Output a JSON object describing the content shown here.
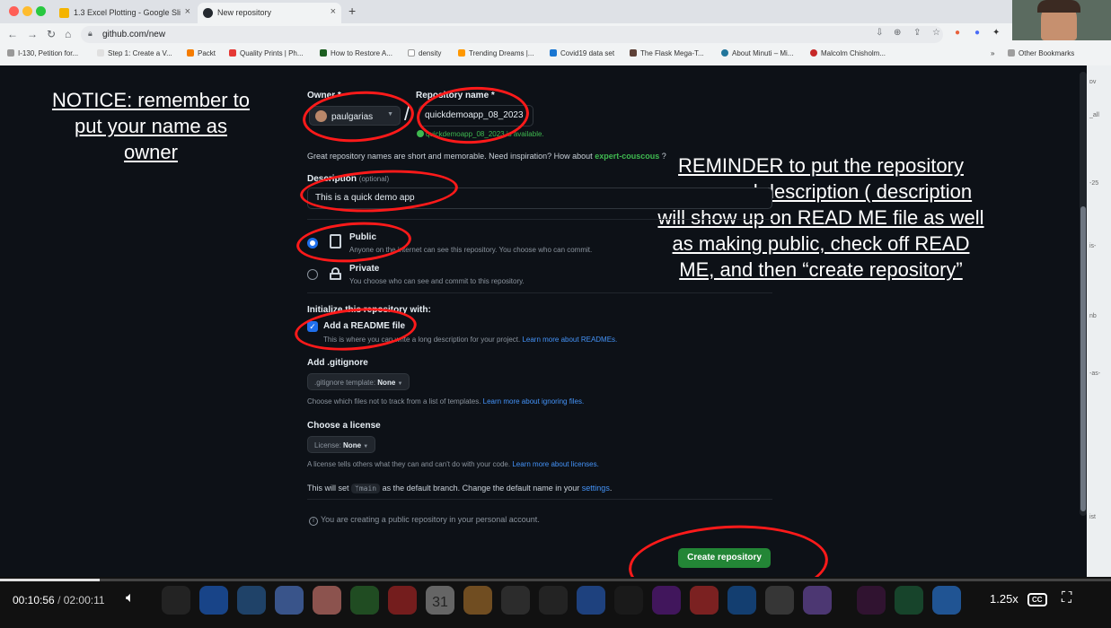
{
  "browser": {
    "tabs": [
      {
        "title": "1.3 Excel Plotting - Google Sli",
        "color": "#f4b400"
      },
      {
        "title": "New repository",
        "color": "#24292f"
      }
    ],
    "url": "github.com/new",
    "bookmarks": [
      "I-130, Petition for...",
      "Step 1: Create a V...",
      "Packt",
      "Quality Prints | Ph...",
      "How to Restore A...",
      "density",
      "Trending Dreams |...",
      "Covid19 data set",
      "The Flask Mega-T...",
      "About Minuti – Mi...",
      "Malcolm Chisholm...",
      "Other Bookmarks"
    ]
  },
  "notes": {
    "left": "NOTICE: remember to put your name as owner",
    "right": "REMINDER to put the repository name and description ( description will show up on READ ME file as well as making public,  check off READ ME, and then “create repository”"
  },
  "form": {
    "owner_label": "Owner *",
    "owner_value": "paulgarias",
    "slash": "/",
    "repo_label": "Repository name *",
    "repo_value": "quickdemoapp_08_2023",
    "available": "quickdemoapp_08_2023 is available.",
    "great_names": "Great repository names are short and memorable. Need inspiration? How about",
    "suggestion": "expert-couscous",
    "great_names_end": " ?",
    "desc_label": "Description",
    "desc_optional": "(optional)",
    "desc_value": "This is a quick demo app",
    "public_label": "Public",
    "public_sub": "Anyone on the internet can see this repository. You choose who can commit.",
    "private_label": "Private",
    "private_sub": "You choose who can see and commit to this repository.",
    "init_label": "Initialize this repository with:",
    "readme_label": "Add a README file",
    "readme_sub": "This is where you can write a long description for your project.",
    "readme_link": "Learn more about READMEs.",
    "gitignore_label": "Add .gitignore",
    "gitignore_dd_prefix": ".gitignore template:",
    "gitignore_dd_value": "None",
    "gitignore_sub": "Choose which files not to track from a list of templates.",
    "gitignore_link": "Learn more about ignoring files.",
    "license_label": "Choose a license",
    "license_dd_prefix": "License:",
    "license_dd_value": "None",
    "license_sub": "A license tells others what they can and can't do with your code.",
    "license_link": "Learn more about licenses.",
    "branch_pre": "This will set",
    "branch_name": "main",
    "branch_post": "as the default branch. Change the default name in your",
    "branch_link": "settings",
    "public_info": "You are creating a public repository in your personal account.",
    "create_button": "Create repository"
  },
  "player": {
    "current": "00:10:56",
    "sep": "/",
    "total": "02:00:11",
    "speed": "1.25x",
    "cc": "CC",
    "progress": 0.09,
    "calendar_day": "31"
  }
}
